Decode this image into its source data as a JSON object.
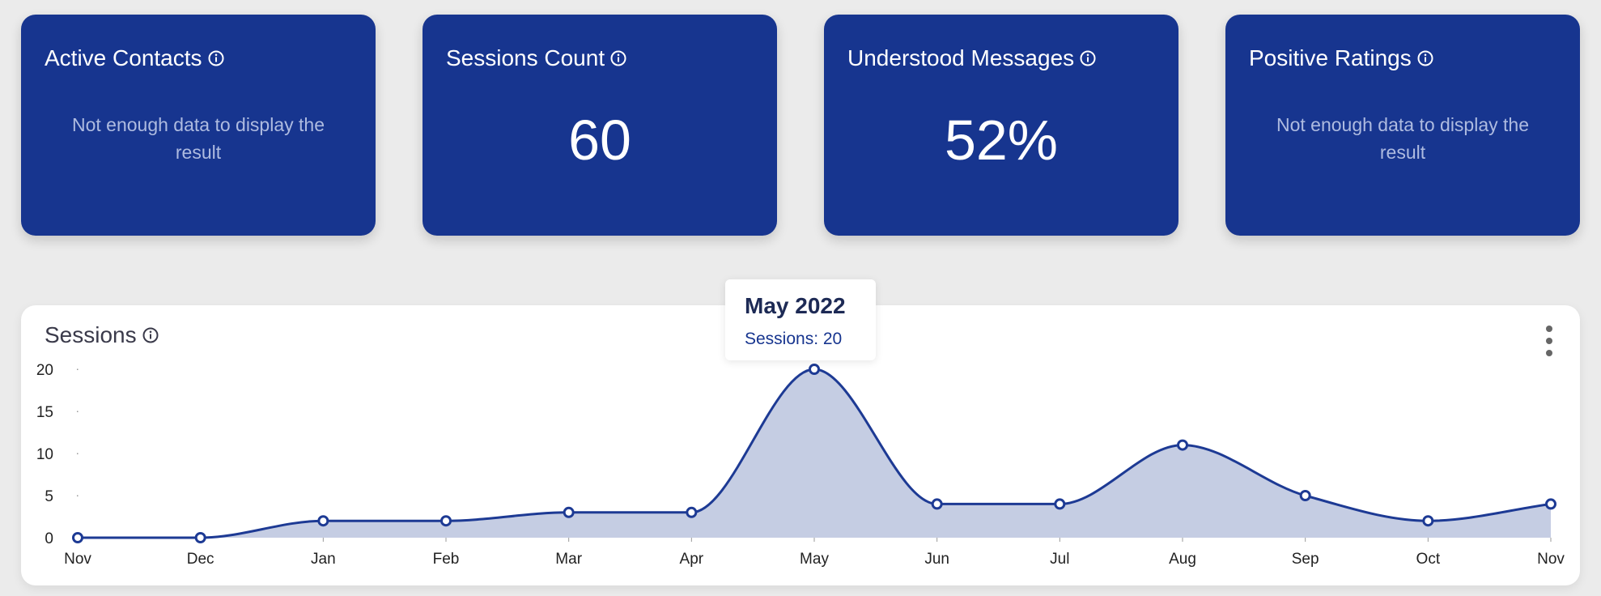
{
  "cards": [
    {
      "title": "Active Contacts",
      "value": null,
      "empty_text": "Not enough data to display the result"
    },
    {
      "title": "Sessions Count",
      "value": "60",
      "empty_text": null
    },
    {
      "title": "Understood Messages",
      "value": "52%",
      "empty_text": null
    },
    {
      "title": "Positive Ratings",
      "value": null,
      "empty_text": "Not enough data to display the result"
    }
  ],
  "sessions_panel": {
    "title": "Sessions",
    "menu_icon": "kebab-menu-icon",
    "info_icon": "info-icon"
  },
  "tooltip": {
    "title": "May 2022",
    "label": "Sessions: 20"
  },
  "colors": {
    "card_bg": "#17358f",
    "line": "#1d3a94",
    "area": "#c5cde3",
    "page_bg": "#ebebeb"
  },
  "chart_data": {
    "type": "area",
    "categories": [
      "Nov",
      "Dec",
      "Jan",
      "Feb",
      "Mar",
      "Apr",
      "May",
      "Jun",
      "Jul",
      "Aug",
      "Sep",
      "Oct",
      "Nov"
    ],
    "series": [
      {
        "name": "Sessions",
        "values": [
          0,
          0,
          2,
          2,
          3,
          3,
          20,
          4,
          4,
          11,
          5,
          2,
          4
        ]
      }
    ],
    "yticks": [
      0,
      5,
      10,
      15,
      20
    ],
    "ylim": [
      0,
      20
    ],
    "title": "Sessions",
    "xlabel": "",
    "ylabel": "",
    "grid": false,
    "legend": "none"
  }
}
